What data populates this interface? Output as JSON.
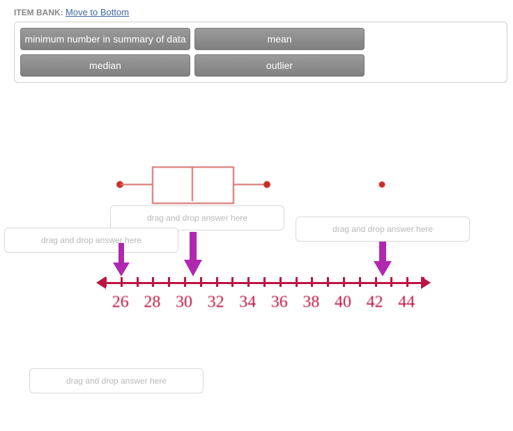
{
  "header": {
    "label": "ITEM BANK:",
    "link_text": "Move to Bottom"
  },
  "bank": {
    "tiles": [
      "minimum number in summary of data",
      "mean",
      "median",
      "outlier"
    ]
  },
  "dropzone_placeholder": "drag and drop answer here",
  "axis": {
    "ticks": [
      25,
      26,
      27,
      28,
      29,
      30,
      31,
      32,
      33,
      34,
      35,
      36,
      37,
      38,
      39,
      40,
      41,
      42,
      43,
      44,
      45
    ],
    "labels": [
      26,
      28,
      30,
      32,
      34,
      36,
      38,
      40,
      42,
      44
    ]
  },
  "chart_data": {
    "type": "boxplot-with-outlier-on-number-line",
    "axis_min": 25,
    "axis_max": 45,
    "min_whisker": 26,
    "q1": 28,
    "median": 30,
    "q3": 33,
    "max_whisker": 35,
    "outlier": 44,
    "arrow_targets": [
      26,
      30,
      44
    ],
    "title": "",
    "xlabel": "",
    "ylabel": ""
  },
  "colors": {
    "axis": "#bd1542",
    "box": "#d66e6a",
    "arrow": "#b028b0",
    "bank_tile": "#8c8c8c",
    "link": "#4067a1"
  }
}
